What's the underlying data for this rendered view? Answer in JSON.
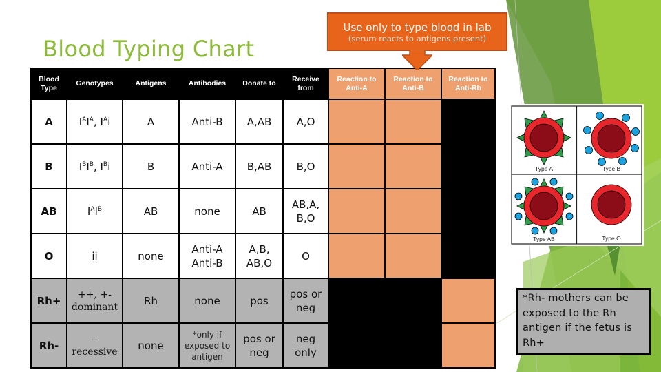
{
  "slide": {
    "title": "Blood Typing Chart",
    "accent_color": "#8cba39",
    "callout": {
      "main": "Use only to type blood in lab",
      "sub": "(serum reacts to antigens present)",
      "color": "#e8641b",
      "icon": "down-arrow-icon"
    },
    "table": {
      "headers": [
        "Blood Type",
        "Genotypes",
        "Antigens",
        "Antibodies",
        "Donate to",
        "Receive from",
        "Reaction to Anti-A",
        "Reaction to Anti-B",
        "Reaction to Anti-Rh"
      ],
      "rows": [
        {
          "blood_type": "A",
          "genotype_parts": [
            "I",
            "A",
            "I",
            "A",
            ", I",
            "A",
            "i"
          ],
          "antigens": "A",
          "antibodies": "Anti-B",
          "donate": "A,AB",
          "receive": "A,O"
        },
        {
          "blood_type": "B",
          "genotype_parts": [
            "I",
            "B",
            "I",
            "B",
            ", I",
            "B",
            "i"
          ],
          "antigens": "B",
          "antibodies": "Anti-A",
          "donate": "B,AB",
          "receive": "B,O"
        },
        {
          "blood_type": "AB",
          "genotype_parts": [
            "I",
            "A",
            "I",
            "B"
          ],
          "antigens": "AB",
          "antibodies": "none",
          "donate": "AB",
          "receive": "AB,A, B,O"
        },
        {
          "blood_type": "O",
          "genotype": "ii",
          "antigens": "none",
          "antibodies": "Anti-A Anti-B",
          "donate": "A,B, AB,O",
          "receive": "O"
        },
        {
          "blood_type": "Rh+",
          "genotype_line1": "++, +-",
          "genotype_line2": "dominant",
          "antigens": "Rh",
          "antibodies": "none",
          "donate": "pos",
          "receive": "pos or neg"
        },
        {
          "blood_type": "Rh-",
          "genotype_line1": "--",
          "genotype_line2": "recessive",
          "antigens": "none",
          "antibodies": "*only if exposed to antigen",
          "donate": "pos or neg",
          "receive": "neg only"
        }
      ],
      "colors": {
        "reaction": "#eea06f",
        "rh_rows": "#b3b3b3",
        "blocked": "#000000"
      }
    },
    "figure": {
      "labels": [
        "Type A",
        "Type B",
        "Type AB",
        "Type O"
      ]
    },
    "note": "*Rh- mothers can be exposed to the Rh antigen if the fetus is Rh+"
  }
}
